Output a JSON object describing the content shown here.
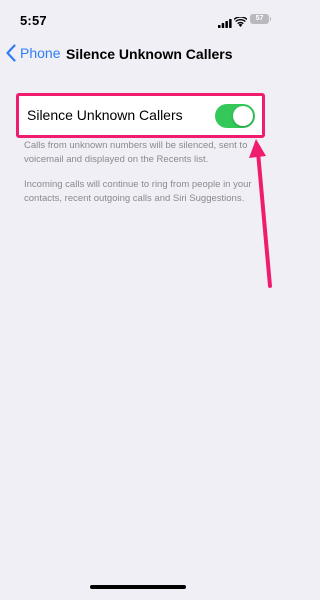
{
  "status_bar": {
    "time": "5:57",
    "battery_level": "57"
  },
  "nav": {
    "back_label": "Phone",
    "title": "Silence Unknown Callers"
  },
  "setting": {
    "label": "Silence Unknown Callers",
    "toggle_on": true,
    "toggle_color": "#34c759",
    "highlight_color": "#f01d6f"
  },
  "footnotes": [
    "Calls from unknown numbers will be silenced, sent to voicemail and displayed on the Recents list.",
    "Incoming calls will continue to ring from people in your contacts, recent outgoing calls and Siri Suggestions."
  ]
}
